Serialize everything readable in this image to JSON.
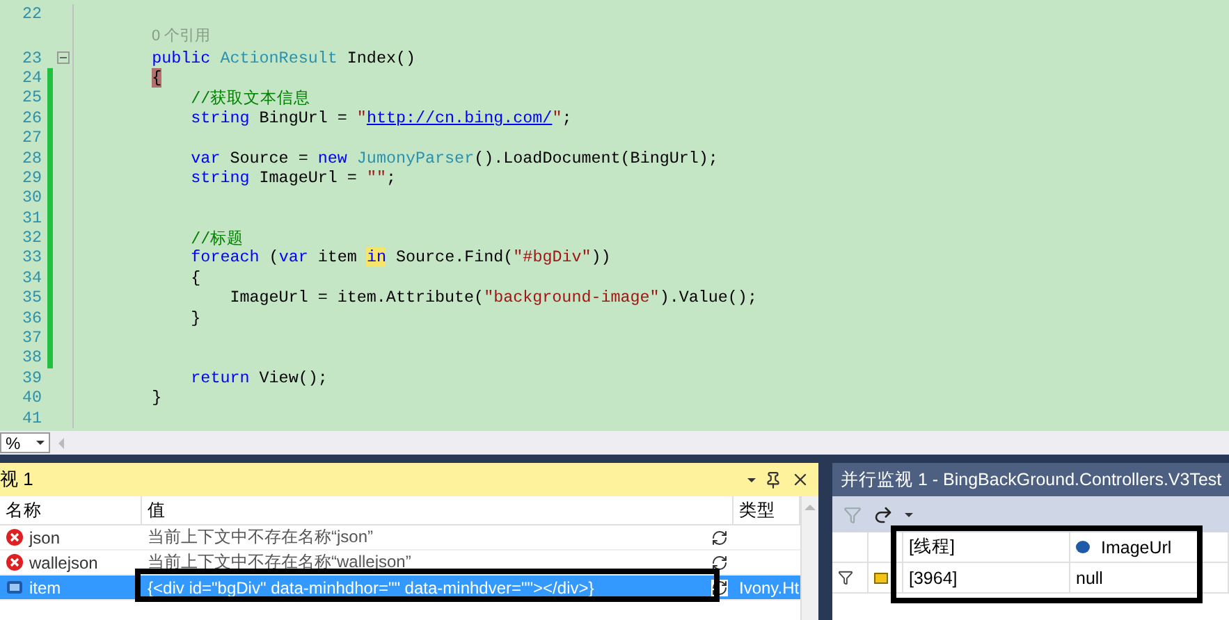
{
  "editor": {
    "lines": [
      {
        "kind": "code",
        "number": "22",
        "changed": false,
        "fold": false
      },
      {
        "kind": "codelens",
        "text": "0 个引用"
      },
      {
        "kind": "code",
        "number": "23",
        "changed": false,
        "fold": true,
        "tokens": [
          {
            "kind": "keyword",
            "s": "        public "
          },
          {
            "kind": "type",
            "s": "ActionResult"
          },
          {
            "kind": "plain",
            "s": " Index()"
          }
        ]
      },
      {
        "kind": "code",
        "number": "24",
        "changed": true,
        "fold": false,
        "tokens": [
          {
            "kind": "brace_match",
            "s": "        {"
          }
        ]
      },
      {
        "kind": "code",
        "number": "25",
        "changed": true,
        "fold": false,
        "tokens": [
          {
            "kind": "comment",
            "s": "            //获取文本信息"
          }
        ]
      },
      {
        "kind": "code",
        "number": "26",
        "changed": true,
        "fold": false,
        "tokens": [
          {
            "kind": "keyword",
            "s": "            string"
          },
          {
            "kind": "plain",
            "s": " BingUrl = "
          },
          {
            "kind": "string",
            "s": "\""
          },
          {
            "kind": "link",
            "s": "http://cn.bing.com/"
          },
          {
            "kind": "string",
            "s": "\""
          },
          {
            "kind": "plain",
            "s": ";"
          }
        ]
      },
      {
        "kind": "code",
        "number": "27",
        "changed": true,
        "fold": false
      },
      {
        "kind": "code",
        "number": "28",
        "changed": true,
        "fold": false,
        "tokens": [
          {
            "kind": "keyword",
            "s": "            var"
          },
          {
            "kind": "plain",
            "s": " Source = "
          },
          {
            "kind": "keyword",
            "s": "new "
          },
          {
            "kind": "type",
            "s": "JumonyParser"
          },
          {
            "kind": "plain",
            "s": "().LoadDocument(BingUrl);"
          }
        ]
      },
      {
        "kind": "code",
        "number": "29",
        "changed": true,
        "fold": false,
        "tokens": [
          {
            "kind": "keyword",
            "s": "            string"
          },
          {
            "kind": "plain",
            "s": " ImageUrl = "
          },
          {
            "kind": "string",
            "s": "\"\""
          },
          {
            "kind": "plain",
            "s": ";"
          }
        ]
      },
      {
        "kind": "code",
        "number": "30",
        "changed": true,
        "fold": false
      },
      {
        "kind": "code",
        "number": "31",
        "changed": true,
        "fold": false
      },
      {
        "kind": "code",
        "number": "32",
        "changed": true,
        "fold": false,
        "tokens": [
          {
            "kind": "comment",
            "s": "            //标题"
          }
        ]
      },
      {
        "kind": "code",
        "number": "33",
        "changed": true,
        "fold": false,
        "tokens": [
          {
            "kind": "keyword",
            "s": "            foreach"
          },
          {
            "kind": "plain",
            "s": " ("
          },
          {
            "kind": "keyword",
            "s": "var"
          },
          {
            "kind": "plain",
            "s": " item "
          },
          {
            "kind": "keyword_highlight",
            "s": "in"
          },
          {
            "kind": "plain",
            "s": " Source.Find("
          },
          {
            "kind": "string",
            "s": "\"#bgDiv\""
          },
          {
            "kind": "plain",
            "s": "))"
          }
        ]
      },
      {
        "kind": "code",
        "number": "34",
        "changed": true,
        "fold": false,
        "tokens": [
          {
            "kind": "plain",
            "s": "            {"
          }
        ]
      },
      {
        "kind": "code",
        "number": "35",
        "changed": true,
        "fold": false,
        "tokens": [
          {
            "kind": "plain",
            "s": "                ImageUrl = item.Attribute("
          },
          {
            "kind": "string",
            "s": "\"background-image\""
          },
          {
            "kind": "plain",
            "s": ").Value();"
          }
        ]
      },
      {
        "kind": "code",
        "number": "36",
        "changed": true,
        "fold": false,
        "tokens": [
          {
            "kind": "plain",
            "s": "            }"
          }
        ]
      },
      {
        "kind": "code",
        "number": "37",
        "changed": true,
        "fold": false
      },
      {
        "kind": "code",
        "number": "38",
        "changed": true,
        "fold": false
      },
      {
        "kind": "code",
        "number": "39",
        "changed": false,
        "fold": false,
        "tokens": [
          {
            "kind": "keyword",
            "s": "            return"
          },
          {
            "kind": "plain",
            "s": " View();"
          }
        ]
      },
      {
        "kind": "code",
        "number": "40",
        "changed": false,
        "fold": false,
        "tokens": [
          {
            "kind": "plain",
            "s": "        }"
          }
        ]
      },
      {
        "kind": "code",
        "number": "41",
        "changed": false,
        "fold": false
      }
    ]
  },
  "zoom": {
    "value": "%"
  },
  "watch": {
    "title": "视 1",
    "columns": [
      "名称",
      "值",
      "类型"
    ],
    "rows": [
      {
        "kind": "error",
        "name": "json",
        "value": "当前上下文中不存在名称“json”",
        "selected": false
      },
      {
        "kind": "error",
        "name": "wallejson",
        "value": "当前上下文中不存在名称“wallejson”",
        "selected": false
      },
      {
        "kind": "object",
        "name": "item",
        "value": "{<div id=\"bgDiv\" data-minhdhor=\"\" data-minhdver=\"\"></div>}",
        "type": "Ivony.Ht",
        "selected": true
      }
    ]
  },
  "parallel_watch": {
    "title": "并行监视 1 - BingBackGround.Controllers.V3Test",
    "columns": [
      "[线程]",
      "ImageUrl"
    ],
    "rows": [
      {
        "thread": "[3964]",
        "value": "null"
      }
    ]
  }
}
